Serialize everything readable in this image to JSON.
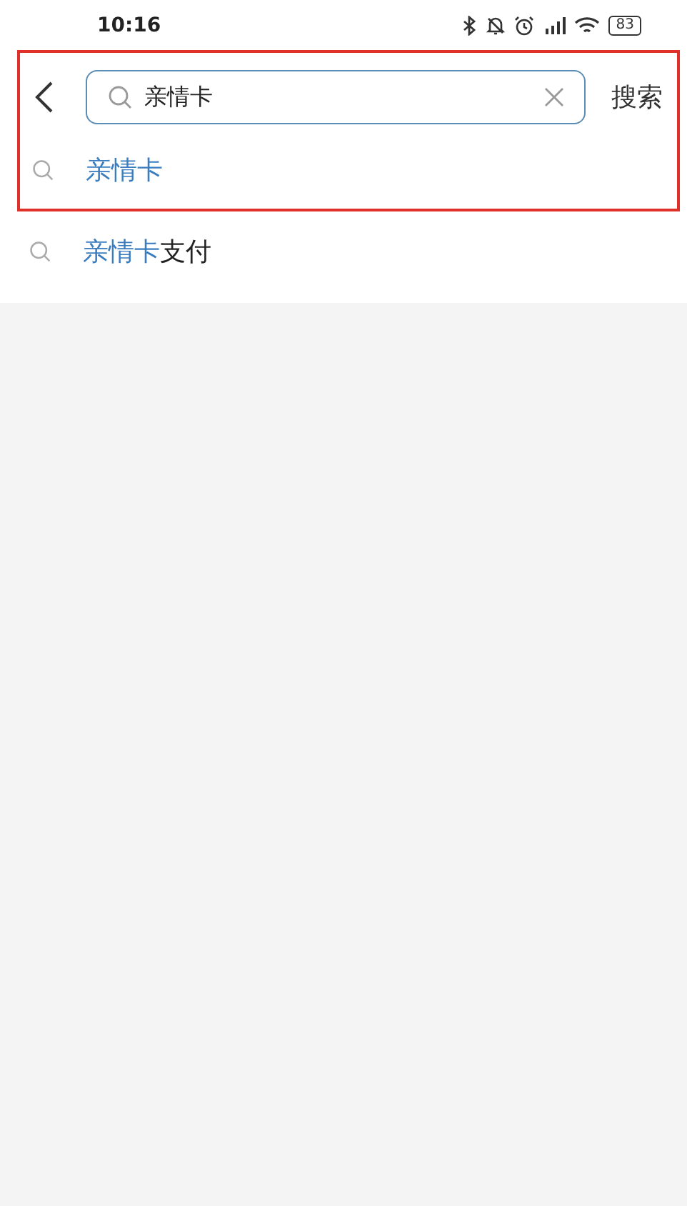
{
  "status_bar": {
    "time": "10:16",
    "battery": "83"
  },
  "search_bar": {
    "value": "亲情卡",
    "button": "搜索"
  },
  "suggestions": [
    {
      "match": "亲情卡"
    },
    {
      "match": "亲情卡",
      "rest": "支付"
    }
  ]
}
